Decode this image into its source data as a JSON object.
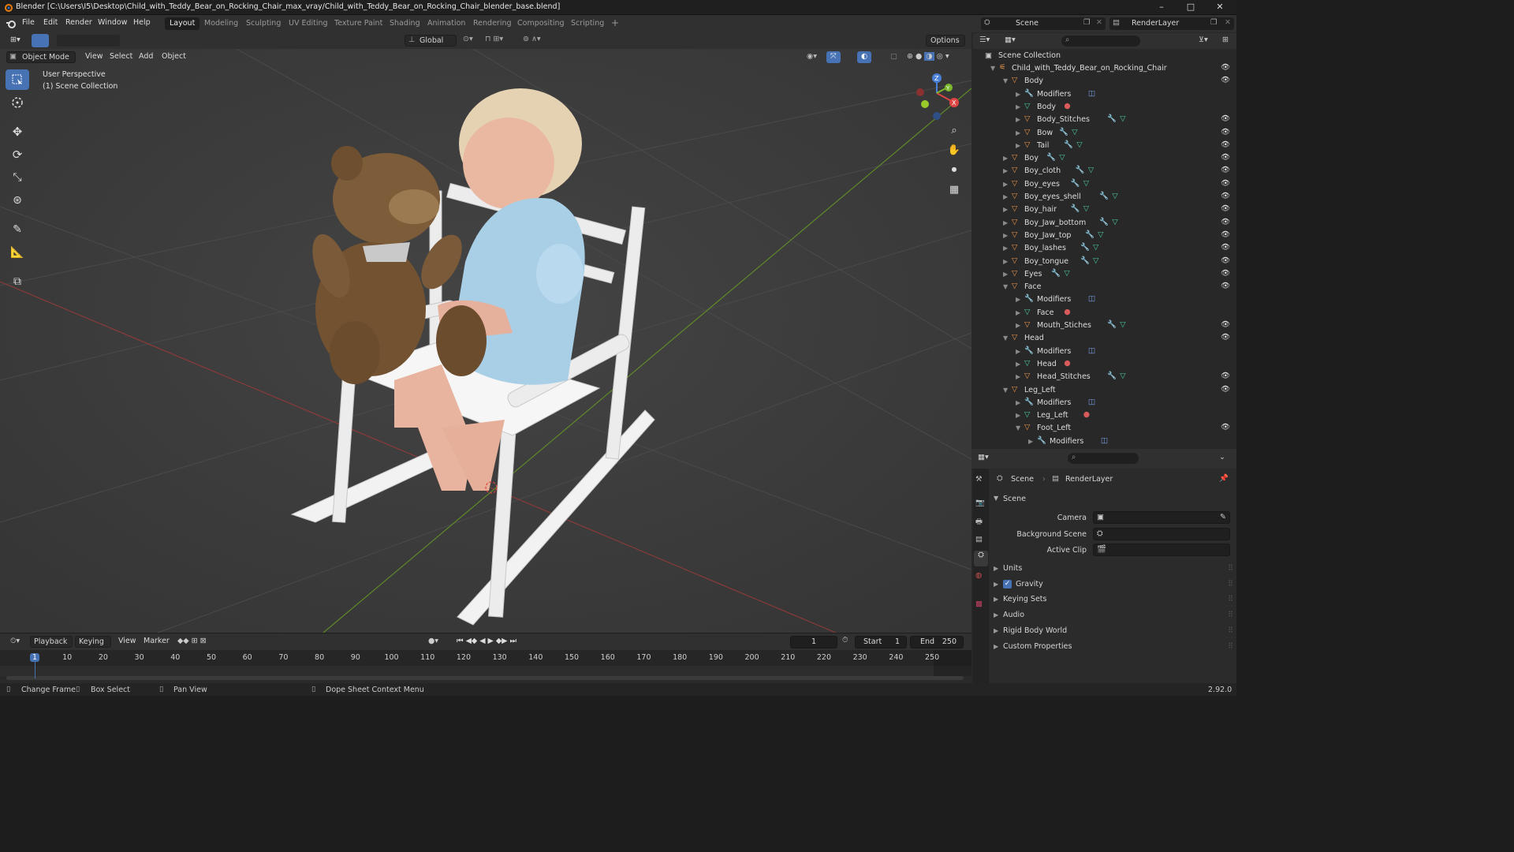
{
  "window": {
    "title": "Blender [C:\\Users\\I5\\Desktop\\Child_with_Teddy_Bear_on_Rocking_Chair_max_vray/Child_with_Teddy_Bear_on_Rocking_Chair_blender_base.blend]",
    "minimize": "–",
    "maximize": "□",
    "close": "✕"
  },
  "menu": [
    "File",
    "Edit",
    "Render",
    "Window",
    "Help"
  ],
  "workspaces": [
    "Layout",
    "Modeling",
    "Sculpting",
    "UV Editing",
    "Texture Paint",
    "Shading",
    "Animation",
    "Rendering",
    "Compositing",
    "Scripting"
  ],
  "active_workspace": "Layout",
  "add_workspace": "+",
  "scene": "Scene",
  "render_layer": "RenderLayer",
  "tool_header": {
    "orientation": "Global",
    "options": "Options"
  },
  "viewport_header": {
    "mode": "Object Mode",
    "menus": [
      "View",
      "Select",
      "Add",
      "Object"
    ]
  },
  "viewport": {
    "perspective": "User Perspective",
    "collection": "(1) Scene Collection",
    "gizmo_x": "X",
    "gizmo_y": "Y",
    "gizmo_z": "Z"
  },
  "outliner": {
    "root": "Scene Collection",
    "rows": [
      {
        "label": "Child_with_Teddy_Bear_on_Rocking_Chair",
        "level": 0,
        "type": "collection",
        "expanded": true,
        "eye": true
      },
      {
        "label": "Body",
        "level": 1,
        "type": "object",
        "expanded": true,
        "eye": true
      },
      {
        "label": "Modifiers",
        "level": 2,
        "type": "modifiers",
        "expanded": false,
        "eye": false
      },
      {
        "label": "Body",
        "level": 2,
        "type": "mesh",
        "expanded": false,
        "eye": false
      },
      {
        "label": "Body_Stitches",
        "level": 2,
        "type": "object",
        "expanded": false,
        "eye": true
      },
      {
        "label": "Bow",
        "level": 2,
        "type": "object",
        "expanded": false,
        "eye": true
      },
      {
        "label": "Tail",
        "level": 2,
        "type": "object",
        "expanded": false,
        "eye": true
      },
      {
        "label": "Boy",
        "level": 1,
        "type": "object",
        "expanded": false,
        "eye": true
      },
      {
        "label": "Boy_cloth",
        "level": 1,
        "type": "object",
        "expanded": false,
        "eye": true
      },
      {
        "label": "Boy_eyes",
        "level": 1,
        "type": "object",
        "expanded": false,
        "eye": true
      },
      {
        "label": "Boy_eyes_shell",
        "level": 1,
        "type": "object",
        "expanded": false,
        "eye": true
      },
      {
        "label": "Boy_hair",
        "level": 1,
        "type": "object",
        "expanded": false,
        "eye": true
      },
      {
        "label": "Boy_Jaw_bottom",
        "level": 1,
        "type": "object",
        "expanded": false,
        "eye": true
      },
      {
        "label": "Boy_Jaw_top",
        "level": 1,
        "type": "object",
        "expanded": false,
        "eye": true
      },
      {
        "label": "Boy_lashes",
        "level": 1,
        "type": "object",
        "expanded": false,
        "eye": true
      },
      {
        "label": "Boy_tongue",
        "level": 1,
        "type": "object",
        "expanded": false,
        "eye": true
      },
      {
        "label": "Eyes",
        "level": 1,
        "type": "object",
        "expanded": false,
        "eye": true
      },
      {
        "label": "Face",
        "level": 1,
        "type": "object",
        "expanded": true,
        "eye": true
      },
      {
        "label": "Modifiers",
        "level": 2,
        "type": "modifiers",
        "expanded": false,
        "eye": false
      },
      {
        "label": "Face",
        "level": 2,
        "type": "mesh",
        "expanded": false,
        "eye": false
      },
      {
        "label": "Mouth_Stiches",
        "level": 2,
        "type": "object",
        "expanded": false,
        "eye": true
      },
      {
        "label": "Head",
        "level": 1,
        "type": "object",
        "expanded": true,
        "eye": true
      },
      {
        "label": "Modifiers",
        "level": 2,
        "type": "modifiers",
        "expanded": false,
        "eye": false
      },
      {
        "label": "Head",
        "level": 2,
        "type": "mesh",
        "expanded": false,
        "eye": false
      },
      {
        "label": "Head_Stitches",
        "level": 2,
        "type": "object",
        "expanded": false,
        "eye": true
      },
      {
        "label": "Leg_Left",
        "level": 1,
        "type": "object",
        "expanded": true,
        "eye": true
      },
      {
        "label": "Modifiers",
        "level": 2,
        "type": "modifiers",
        "expanded": false,
        "eye": false
      },
      {
        "label": "Leg_Left",
        "level": 2,
        "type": "mesh",
        "expanded": false,
        "eye": false
      },
      {
        "label": "Foot_Left",
        "level": 2,
        "type": "object",
        "expanded": true,
        "eye": true
      },
      {
        "label": "Modifiers",
        "level": 3,
        "type": "modifiers",
        "expanded": false,
        "eye": false
      }
    ]
  },
  "properties": {
    "breadcrumb_scene": "Scene",
    "breadcrumb_layer": "RenderLayer",
    "section": "Scene",
    "fields": [
      {
        "label": "Camera",
        "value": ""
      },
      {
        "label": "Background Scene",
        "value": ""
      },
      {
        "label": "Active Clip",
        "value": ""
      }
    ],
    "panels": [
      {
        "label": "Units",
        "checkbox": false
      },
      {
        "label": "Gravity",
        "checkbox": true
      },
      {
        "label": "Keying Sets",
        "checkbox": false
      },
      {
        "label": "Audio",
        "checkbox": false
      },
      {
        "label": "Rigid Body World",
        "checkbox": false
      },
      {
        "label": "Custom Properties",
        "checkbox": false
      }
    ]
  },
  "timeline": {
    "menus": [
      "Playback",
      "Keying",
      "View",
      "Marker"
    ],
    "current_frame": "1",
    "start_label": "Start",
    "start": "1",
    "end_label": "End",
    "end": "250",
    "ruler": [
      "1",
      "10",
      "20",
      "30",
      "40",
      "50",
      "60",
      "70",
      "80",
      "90",
      "100",
      "110",
      "120",
      "130",
      "140",
      "150",
      "160",
      "170",
      "180",
      "190",
      "200",
      "210",
      "220",
      "230",
      "240",
      "250"
    ]
  },
  "statusbar": {
    "items": [
      "Change Frame",
      "Box Select",
      "Pan View",
      "Dope Sheet Context Menu"
    ],
    "version": "2.92.0"
  },
  "colors": {
    "accent": "#4772b3",
    "viewport_bg": "#3c3c3c",
    "panel_bg": "#282828",
    "object_icon": "#e8944a",
    "mesh_icon": "#48c7a0",
    "modifier_icon": "#7a9be0",
    "material_icon": "#d85a5a",
    "axis_red": "#b84444",
    "axis_green": "#6a9a2c"
  }
}
